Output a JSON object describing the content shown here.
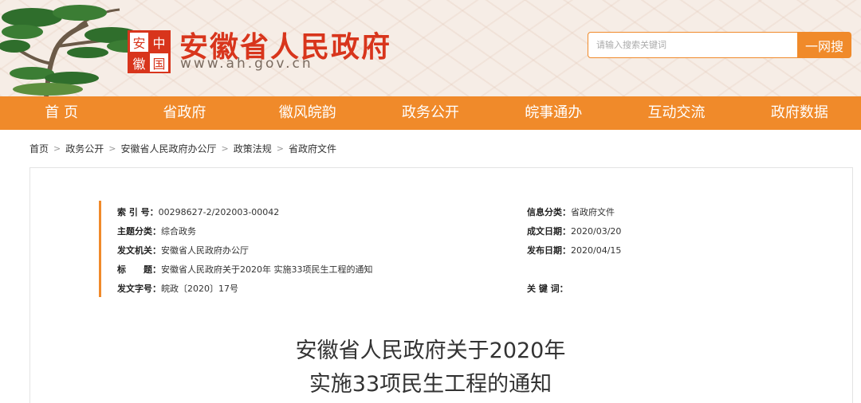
{
  "header": {
    "emblem": [
      "安",
      "中",
      "徽",
      "国"
    ],
    "site_title": "安徽省人民政府",
    "site_url": "www.ah.gov.cn",
    "search_placeholder": "请输入搜索关键词",
    "search_button": "一网搜"
  },
  "nav": {
    "items": [
      "首 页",
      "省政府",
      "徽风皖韵",
      "政务公开",
      "皖事通办",
      "互动交流",
      "政府数据"
    ]
  },
  "breadcrumb": [
    "首页",
    "政务公开",
    "安徽省人民政府办公厅",
    "政策法规",
    "省政府文件"
  ],
  "meta": {
    "left": [
      {
        "label": "索 引 号：",
        "value": "00298627-2/202003-00042"
      },
      {
        "label": "主题分类：",
        "value": "综合政务"
      },
      {
        "label": "发文机关：",
        "value": "安徽省人民政府办公厅"
      },
      {
        "label": "标　　题：",
        "value": "安徽省人民政府关于2020年 实施33项民生工程的通知"
      },
      {
        "label": "发文字号：",
        "value": "皖政〔2020〕17号"
      }
    ],
    "right": [
      {
        "label": "信息分类：",
        "value": "省政府文件"
      },
      {
        "label": "成文日期：",
        "value": "2020/03/20"
      },
      {
        "label": "发布日期：",
        "value": "2020/04/15"
      },
      {
        "label": "关 键 词：",
        "value": ""
      }
    ]
  },
  "document": {
    "title_line1": "安徽省人民政府关于2020年",
    "title_line2": "实施33项民生工程的通知"
  },
  "colors": {
    "brand_red": "#d8351c",
    "nav_orange": "#f08a2a",
    "header_bg": "#f6ede6"
  }
}
